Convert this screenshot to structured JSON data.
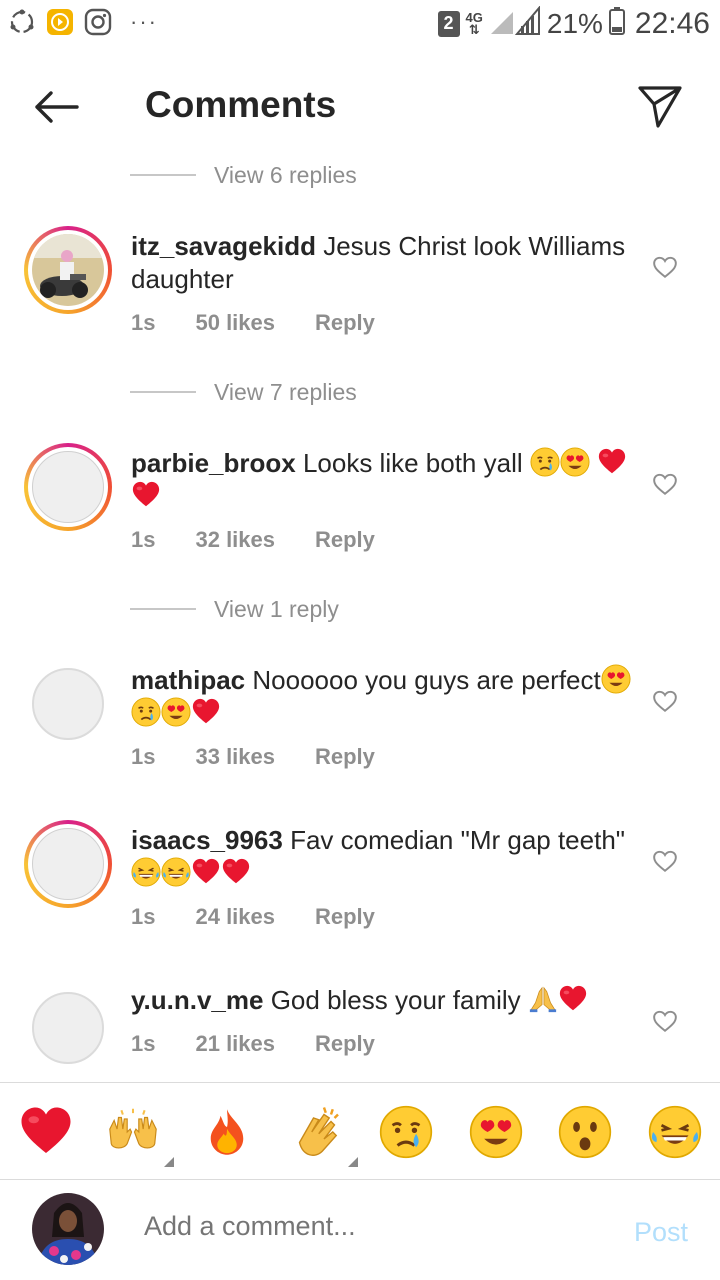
{
  "status_bar": {
    "sim": "2",
    "network": "4G",
    "battery": "21%",
    "time": "22:46",
    "more": "···",
    "icons": [
      "sync-icon",
      "play-store-icon",
      "instagram-icon"
    ]
  },
  "header": {
    "title": "Comments"
  },
  "comments": [
    {
      "replies_label": "View 6 replies",
      "username": "itz_savagekidd",
      "text": "Jesus Christ look Williams daughter",
      "time": "1s",
      "likes": "50 likes",
      "reply": "Reply",
      "avatar": "photo-ring"
    },
    {
      "replies_label": "View 7 replies",
      "username": "parbie_broox",
      "text": "Looks like both yall",
      "emojis": [
        "crying-face",
        "heart-eyes",
        "red-heart",
        "red-heart"
      ],
      "time": "1s",
      "likes": "32 likes",
      "reply": "Reply",
      "avatar": "ring"
    },
    {
      "replies_label": "View 1 reply",
      "username": "mathipac",
      "text": "Noooooo you guys are perfect",
      "emojis": [
        "heart-eyes",
        "crying-face",
        "heart-eyes",
        "red-heart"
      ],
      "time": "1s",
      "likes": "33 likes",
      "reply": "Reply",
      "avatar": "plain"
    },
    {
      "username": "isaacs_9963",
      "text": "Fav comedian \"Mr gap teeth\"",
      "emojis": [
        "laughing-face",
        "laughing-face",
        "red-heart",
        "red-heart"
      ],
      "time": "1s",
      "likes": "24 likes",
      "reply": "Reply",
      "avatar": "ring"
    },
    {
      "username": "y.u.n.v_me",
      "text": "God bless your family",
      "emojis": [
        "praying-hands",
        "red-heart"
      ],
      "time": "1s",
      "likes": "21 likes",
      "reply": "Reply",
      "avatar": "plain"
    }
  ],
  "emoji_bar": [
    "red-heart",
    "raising-hands",
    "fire",
    "clapping-hands",
    "crying-face",
    "heart-eyes",
    "surprised-face",
    "laughing-face"
  ],
  "add_comment": {
    "placeholder": "Add a comment...",
    "post_label": "Post"
  },
  "colors": {
    "accent_post": "#b2dffc",
    "muted_text": "#8e8e8e",
    "heart": "#e8162f"
  }
}
